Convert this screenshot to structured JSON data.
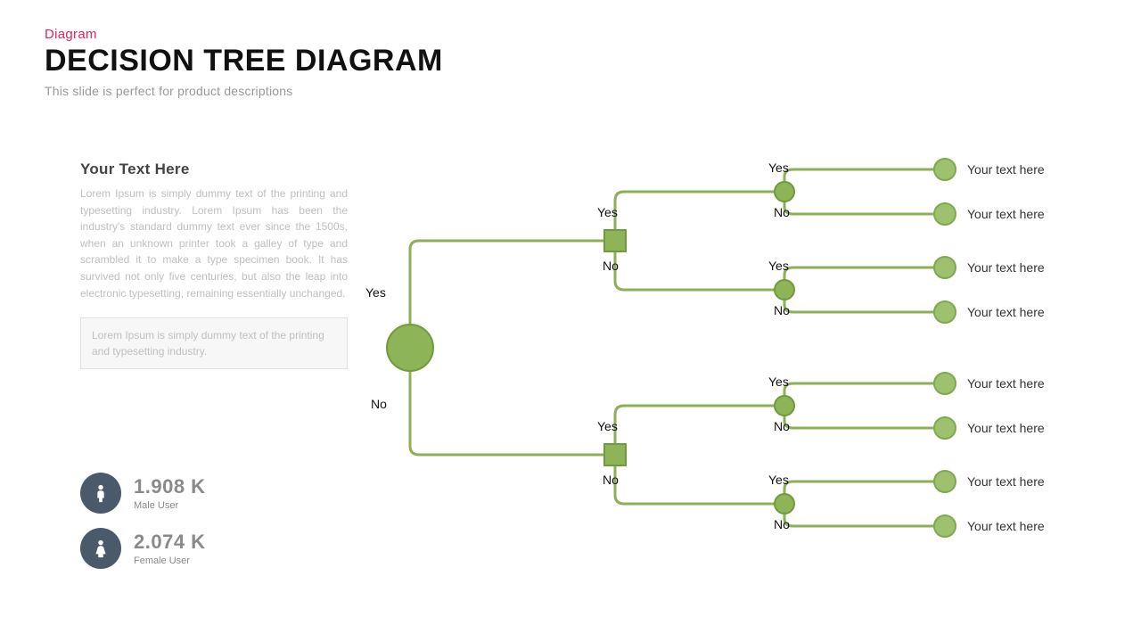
{
  "header": {
    "kicker": "Diagram",
    "title": "DECISION TREE DIAGRAM",
    "subtitle": "This slide is perfect for product descriptions"
  },
  "side": {
    "heading": "Your Text Here",
    "body": "Lorem Ipsum is simply dummy text of the printing and typesetting industry. Lorem Ipsum has been the industry's standard dummy text ever since the 1500s, when an unknown printer took a galley of type and scrambled it to make a type specimen book. It has survived not only five centuries, but also the leap into electronic typesetting, remaining essentially unchanged.",
    "box": "Lorem Ipsum is simply dummy text of the printing and typesetting industry."
  },
  "stats": {
    "male": {
      "value": "1.908 K",
      "label": "Male User"
    },
    "female": {
      "value": "2.074 K",
      "label": "Female User"
    }
  },
  "labels": {
    "yes": "Yes",
    "no": "No"
  },
  "leaves": {
    "l1": "Your text here",
    "l2": "Your text here",
    "l3": "Your text here",
    "l4": "Your text here",
    "l5": "Your text here",
    "l6": "Your text here",
    "l7": "Your text here",
    "l8": "Your text here"
  },
  "colors": {
    "line": "#8bb057",
    "node_fill": "#8db558",
    "node_stroke": "#6f9a3d",
    "leaf_fill": "#9dc16e",
    "stat_icon_bg": "#4a5a6a"
  },
  "chart_data": {
    "type": "decision-tree",
    "title": "DECISION TREE DIAGRAM",
    "levels": 3,
    "branch_labels": [
      "Yes",
      "No"
    ],
    "root": {
      "shape": "circle"
    },
    "level2": {
      "shape": "square",
      "count": 2
    },
    "level3": {
      "shape": "circle-small",
      "count": 4
    },
    "leaves": {
      "count": 8,
      "label": "Your text here"
    }
  }
}
